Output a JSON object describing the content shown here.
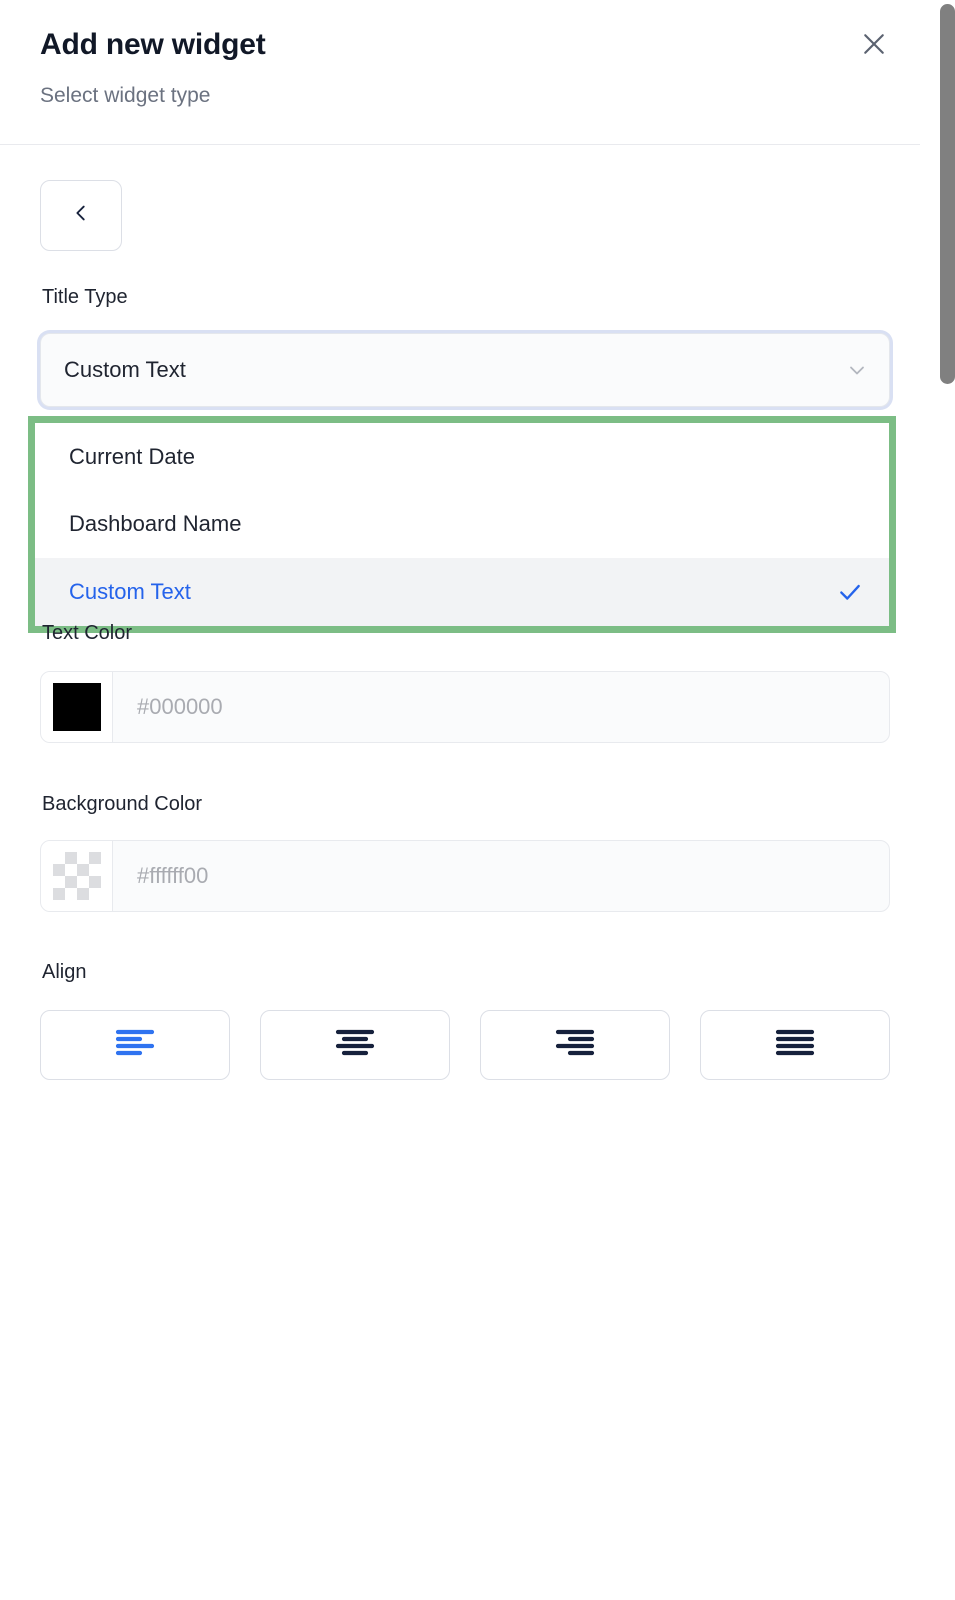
{
  "header": {
    "title": "Add new widget",
    "subtitle": "Select widget type",
    "close_icon": "close-icon"
  },
  "back_button": {
    "icon": "chevron-left-icon",
    "label": ""
  },
  "fields": {
    "title_type": {
      "label": "Title Type",
      "selected_value": "Custom Text",
      "chevron_icon": "chevron-down-icon",
      "options": [
        {
          "label": "Current Date",
          "selected": false
        },
        {
          "label": "Dashboard Name",
          "selected": false
        },
        {
          "label": "Custom Text",
          "selected": true
        }
      ],
      "highlight_color": "#7cbd85",
      "selected_option_color": "#2563eb",
      "check_icon": "check-icon"
    },
    "text_color": {
      "label": "Text Color",
      "value": "",
      "placeholder": "#000000",
      "swatch_color": "#000000",
      "swatch_icon": "color-swatch-black"
    },
    "background_color": {
      "label": "Background Color",
      "value": "",
      "placeholder": "#ffffff00",
      "swatch_color": "#ffffff00",
      "swatch_icon": "color-swatch-transparent-checkerboard"
    },
    "align": {
      "label": "Align",
      "active_index": 0,
      "active_color": "#2f73f0",
      "inactive_color": "#16213c",
      "options": [
        {
          "name": "align-left",
          "icon": "align-left-icon",
          "active": true
        },
        {
          "name": "align-center",
          "icon": "align-center-icon",
          "active": false
        },
        {
          "name": "align-right",
          "icon": "align-right-icon",
          "active": false
        },
        {
          "name": "align-justify",
          "icon": "align-justify-icon",
          "active": false
        }
      ]
    }
  },
  "scrollbar": {
    "orientation": "vertical",
    "thumb_position": "top"
  }
}
